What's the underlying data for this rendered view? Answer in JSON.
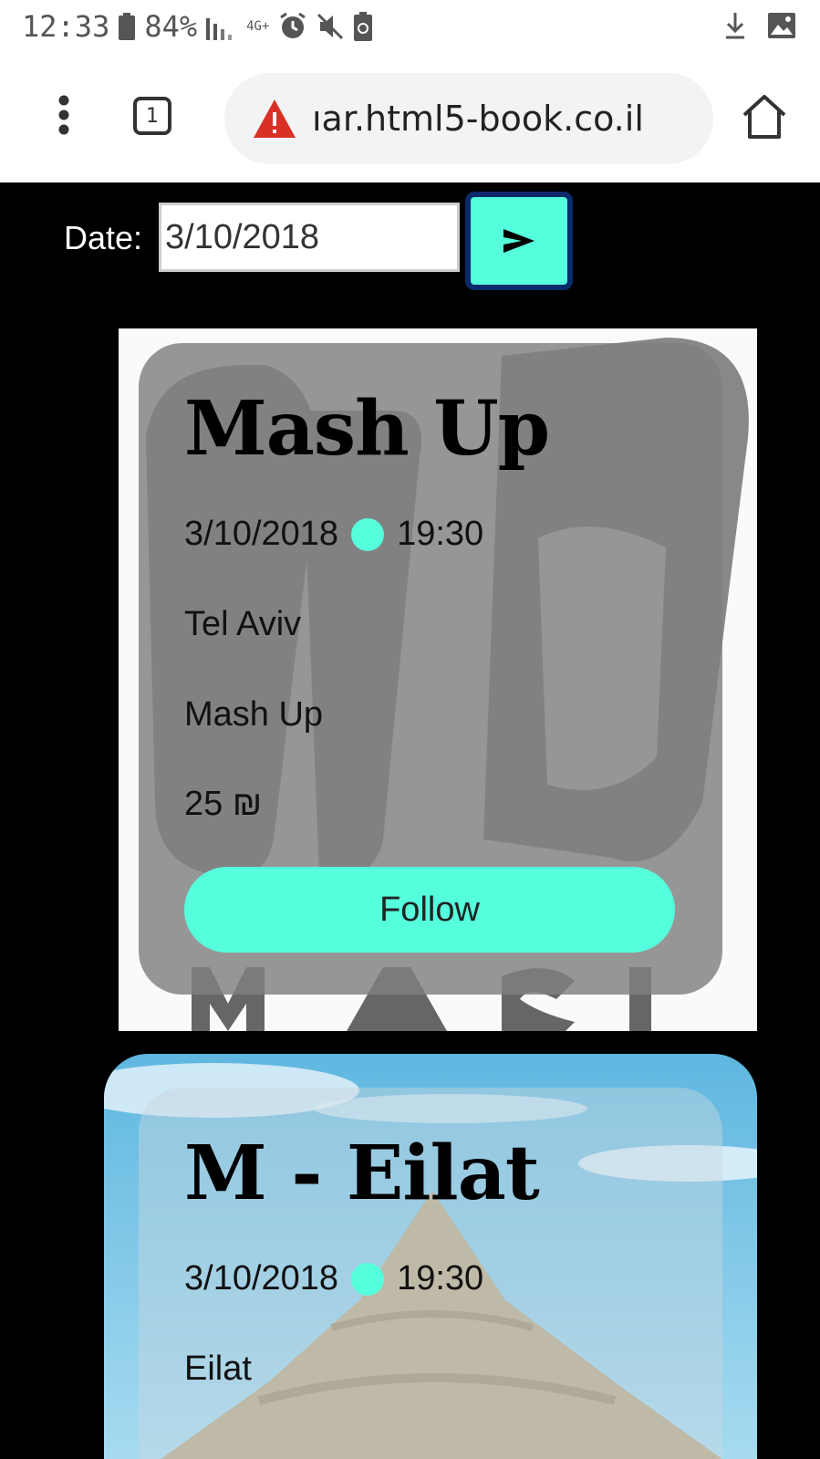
{
  "status_bar": {
    "time": "12:33",
    "battery": "84%",
    "network": "4G+"
  },
  "browser": {
    "tab_count": "1",
    "url": "ıar.html5-book.co.il"
  },
  "filter": {
    "date_label": "Date:",
    "date_value": "3/10/2018"
  },
  "events": [
    {
      "title": "Mash Up",
      "date": "3/10/2018",
      "time": "19:30",
      "location": "Tel Aviv",
      "venue": "Mash Up",
      "price": "25 ₪",
      "follow_label": "Follow"
    },
    {
      "title": "M - Eilat",
      "date": "3/10/2018",
      "time": "19:30",
      "location": "Eilat"
    }
  ],
  "colors": {
    "accent": "#55ffdd",
    "button_border": "#0a2a6b",
    "warning": "#d93025"
  }
}
